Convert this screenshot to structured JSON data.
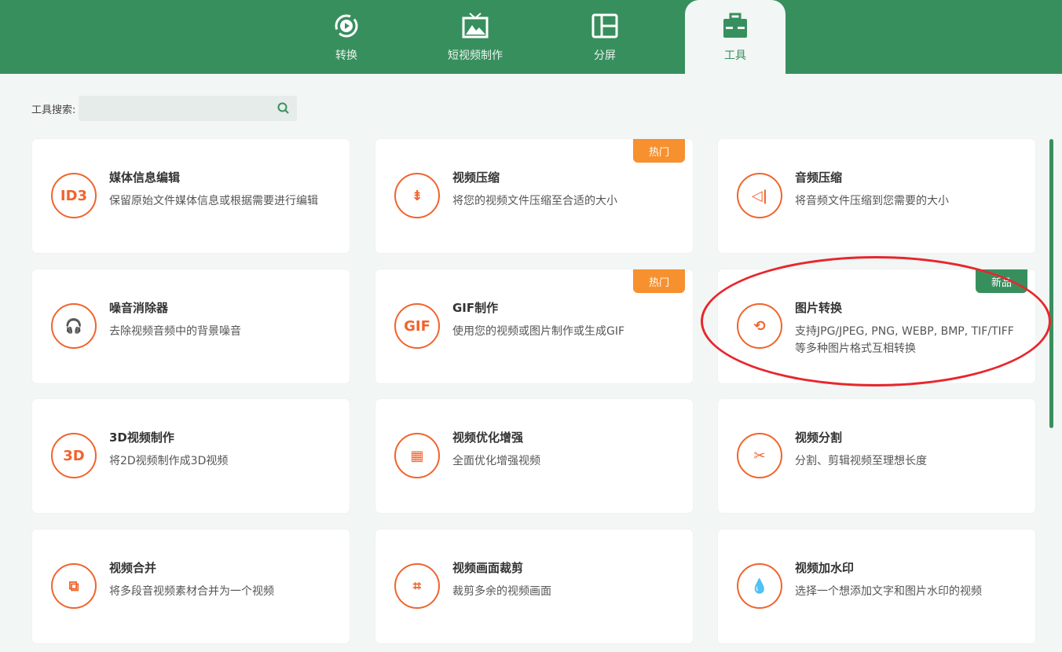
{
  "tabs": [
    {
      "label": "转换",
      "icon": "convert-icon"
    },
    {
      "label": "短视频制作",
      "icon": "tv-icon"
    },
    {
      "label": "分屏",
      "icon": "split-screen-icon"
    },
    {
      "label": "工具",
      "icon": "toolbox-icon",
      "active": true
    }
  ],
  "search": {
    "label": "工具搜索:",
    "value": ""
  },
  "colors": {
    "brand": "#388f5e",
    "accent": "#f0642d",
    "hot": "#f7902e"
  },
  "tools": [
    {
      "title": "媒体信息编辑",
      "desc": "保留原始文件媒体信息或根据需要进行编辑",
      "icon": "ID3"
    },
    {
      "title": "视频压缩",
      "desc": "将您的视频文件压缩至合适的大小",
      "icon": "⇟",
      "badge": "热门"
    },
    {
      "title": "音频压缩",
      "desc": "将音频文件压缩到您需要的大小",
      "icon": "◁|"
    },
    {
      "title": "噪音消除器",
      "desc": "去除视频音频中的背景噪音",
      "icon": "🎧"
    },
    {
      "title": "GIF制作",
      "desc": "使用您的视频或图片制作或生成GIF",
      "icon": "GIF",
      "badge": "热门"
    },
    {
      "title": "图片转换",
      "desc": "支持JPG/JPEG, PNG, WEBP, BMP, TIF/TIFF等多种图片格式互相转换",
      "icon": "⟲",
      "badge": "新品"
    },
    {
      "title": "3D视频制作",
      "desc": "将2D视频制作成3D视频",
      "icon": "3D"
    },
    {
      "title": "视频优化增强",
      "desc": "全面优化增强视频",
      "icon": "▦"
    },
    {
      "title": "视频分割",
      "desc": "分割、剪辑视频至理想长度",
      "icon": "✂"
    },
    {
      "title": "视频合并",
      "desc": "将多段音视频素材合并为一个视频",
      "icon": "⧉"
    },
    {
      "title": "视频画面裁剪",
      "desc": "裁剪多余的视频画面",
      "icon": "⌗"
    },
    {
      "title": "视频加水印",
      "desc": "选择一个想添加文字和图片水印的视频",
      "icon": "💧"
    }
  ]
}
